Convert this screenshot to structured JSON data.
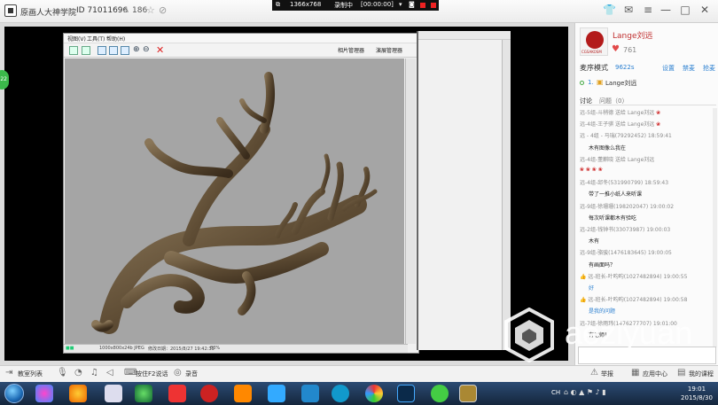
{
  "titlebar": {
    "room_title": "原画人大神学院",
    "room_id": "ID 71011696",
    "viewer_count": "186",
    "viewer_icon": "person-icon",
    "star_icon": "star-icon",
    "share_icon": "share-icon"
  },
  "window_controls": [
    "shirt-icon",
    "feedback-icon",
    "menu-icon",
    "minimize-icon",
    "maximize-icon",
    "close-icon"
  ],
  "record_bar": {
    "resolution": "1366x768",
    "status": "录制中",
    "timer": "[00:00:00]"
  },
  "image_viewer": {
    "menus": [
      "视图(V)",
      "工具(T)",
      "帮助(H)"
    ],
    "photo_manager": "相片管理器",
    "ppt_manager": "演展管理器",
    "status_file": "1000x800x24b JPEG",
    "status_date": "修改日期：2015/8/27 19:42:33",
    "status_zoom": "83%"
  },
  "teacher": {
    "name": "Lange刘远",
    "likes": "761",
    "avatar_caption": "CGSAKOSM"
  },
  "mode": {
    "label": "麦序模式",
    "count": "9622s",
    "links": [
      "设置",
      "禁麦",
      "抢麦"
    ]
  },
  "queue": {
    "number": "1.",
    "name": "Lange刘远"
  },
  "tabs": {
    "discuss": "讨论",
    "questions": "问题（0）"
  },
  "chat": [
    {
      "kind": "sys",
      "text": "远-5组-斗稍德 送给 Lange刘远",
      "flowers": 1
    },
    {
      "kind": "sys",
      "text": "远-4组-王子骐 送给 Lange刘远",
      "flowers": 1
    },
    {
      "kind": "sys",
      "text": "远 - 4组 - 马瑞(79292452) 18:59:41"
    },
    {
      "kind": "msg",
      "text": "木有图像么我在"
    },
    {
      "kind": "sys",
      "text": "远-4组-董麒晓 送给 Lange刘远"
    },
    {
      "kind": "flowers",
      "text": "",
      "flowers": 4
    },
    {
      "kind": "sys",
      "text": "远-4组-邱冬(531990799) 18:59:43"
    },
    {
      "kind": "msg",
      "text": "带了一推小纸人来听课"
    },
    {
      "kind": "sys",
      "text": "远-9组-徐珊珊(198202047) 19:00:02"
    },
    {
      "kind": "msg",
      "text": "每次听课都木有验吃"
    },
    {
      "kind": "sys",
      "text": "远-2组-钱钟书(33073987) 19:00:03"
    },
    {
      "kind": "msg",
      "text": "木有"
    },
    {
      "kind": "sys",
      "text": "远-9组-骆骏(1476183645) 19:00:05"
    },
    {
      "kind": "msg",
      "text": "有画面吗？"
    },
    {
      "kind": "sys",
      "text": "远-班长-叶昀昀(1027482894) 19:00:55",
      "thumb": true
    },
    {
      "kind": "blue",
      "text": "好"
    },
    {
      "kind": "sys",
      "text": "远-班长-叶昀昀(1027482894) 19:00:58",
      "thumb": true
    },
    {
      "kind": "blue",
      "text": "是我的问题"
    },
    {
      "kind": "sys",
      "text": "远-7组-徐雨玮(1476277707) 19:01:00"
    },
    {
      "kind": "msg",
      "text": "有老师！"
    }
  ],
  "bottom_bar": {
    "courseware": "教室列表",
    "push_to_talk": "按住F2说话",
    "record": "录音",
    "report": "举报",
    "app_center": "应用中心",
    "my_courses": "我的课程"
  },
  "taskbar": {
    "lang": "CH",
    "time": "19:01",
    "date": "2015/8/30"
  },
  "side_badge": "22",
  "watermark": {
    "brand": "aeziyuan",
    "domain": ".com"
  },
  "colors": {
    "accent_blue": "#2a7fd0",
    "teacher_red": "#c03030",
    "canvas_gray": "#a5a5a5",
    "taskbar": "#1f3a5e"
  }
}
